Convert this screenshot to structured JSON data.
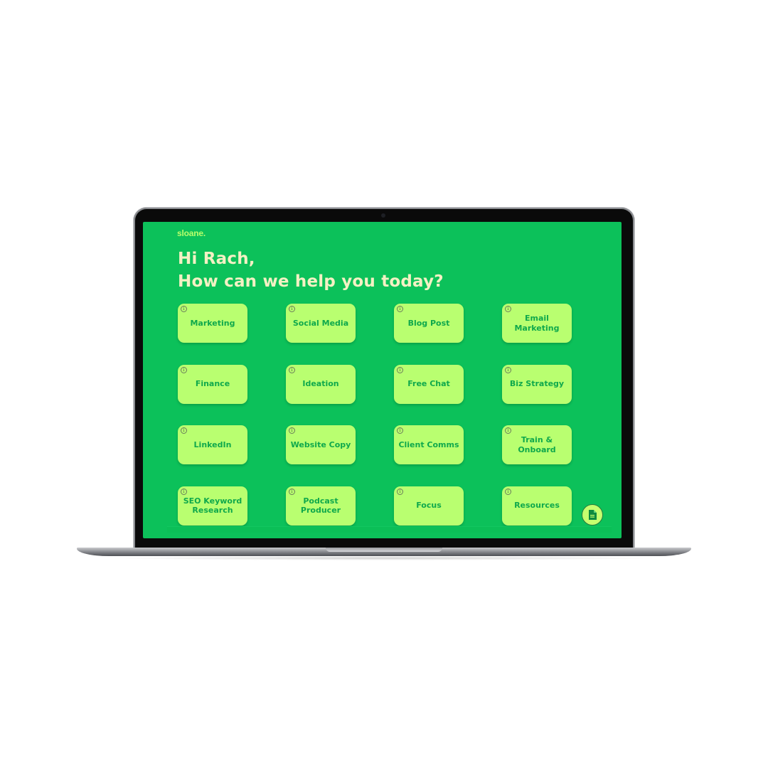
{
  "app": {
    "brand": "sloane.",
    "greeting_line1": "Hi Rach,",
    "greeting_line2": "How can we help you today?"
  },
  "cards": [
    {
      "label": "Marketing"
    },
    {
      "label": "Social Media"
    },
    {
      "label": "Blog Post"
    },
    {
      "label": "Email\nMarketing"
    },
    {
      "label": "Finance"
    },
    {
      "label": "Ideation"
    },
    {
      "label": "Free Chat"
    },
    {
      "label": "Biz Strategy"
    },
    {
      "label": "LinkedIn"
    },
    {
      "label": "Website Copy"
    },
    {
      "label": "Client Comms"
    },
    {
      "label": "Train &\nOnboard"
    },
    {
      "label": "SEO Keyword\nResearch"
    },
    {
      "label": "Podcast\nProducer"
    },
    {
      "label": "Focus"
    },
    {
      "label": "Resources"
    }
  ],
  "icons": {
    "card_info": "info-icon",
    "fab": "document-icon",
    "info_glyph": "i"
  },
  "colors": {
    "screen_bg": "#0cc15a",
    "card_bg": "#b9ff70",
    "card_text": "#0fa84c",
    "greeting_text": "#f4f1c4",
    "brand_text": "#b8ff6b"
  }
}
